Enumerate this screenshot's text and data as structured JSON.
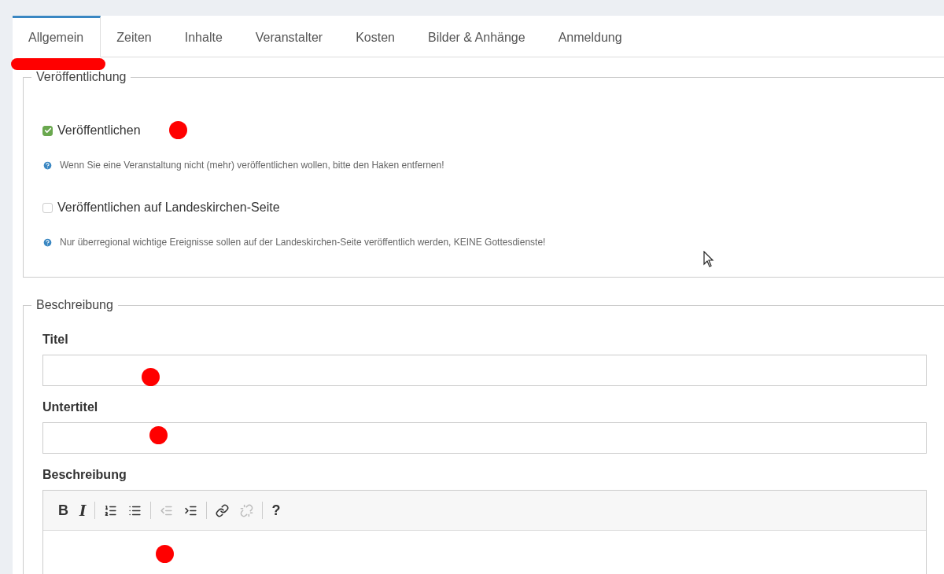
{
  "tabs": [
    {
      "label": "Allgemein",
      "selected": true
    },
    {
      "label": "Zeiten",
      "selected": false
    },
    {
      "label": "Inhalte",
      "selected": false
    },
    {
      "label": "Veranstalter",
      "selected": false
    },
    {
      "label": "Kosten",
      "selected": false
    },
    {
      "label": "Bilder & Anhänge",
      "selected": false
    },
    {
      "label": "Anmeldung",
      "selected": false
    }
  ],
  "publication": {
    "legend": "Veröffentlichung",
    "options": [
      {
        "label": "Veröffentlichen",
        "checked": true,
        "help": "Wenn Sie eine Veranstaltung nicht (mehr) veröffentlichen wollen, bitte den Haken entfernen!"
      },
      {
        "label": "Veröffentlichen auf Landeskirchen-Seite",
        "checked": false,
        "help": "Nur überregional wichtige Ereignisse sollen auf der Landeskirchen-Seite veröffentlich werden, KEINE Gottesdienste!"
      }
    ]
  },
  "description": {
    "legend": "Beschreibung",
    "fields": [
      {
        "label": "Titel"
      },
      {
        "label": "Untertitel"
      }
    ],
    "editor": {
      "label": "Beschreibung",
      "toolbar": [
        {
          "kind": "bold",
          "text": "B",
          "disabled": false
        },
        {
          "kind": "italic",
          "text": "I",
          "disabled": false
        },
        {
          "kind": "separator"
        },
        {
          "kind": "ordered-list",
          "disabled": false
        },
        {
          "kind": "bullet-list",
          "disabled": false
        },
        {
          "kind": "separator"
        },
        {
          "kind": "outdent",
          "disabled": true
        },
        {
          "kind": "indent",
          "disabled": false
        },
        {
          "kind": "separator"
        },
        {
          "kind": "link",
          "disabled": false
        },
        {
          "kind": "unlink",
          "disabled": true
        },
        {
          "kind": "separator"
        },
        {
          "kind": "help",
          "text": "?",
          "disabled": false
        }
      ]
    }
  }
}
